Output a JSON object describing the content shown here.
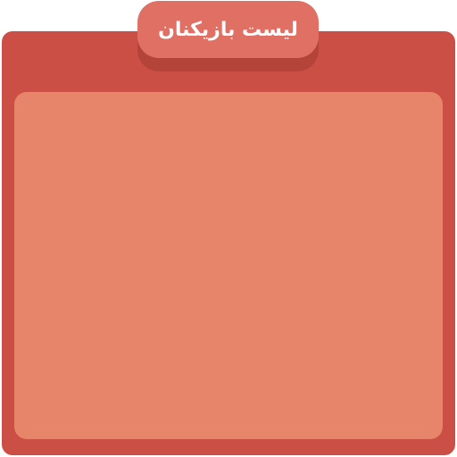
{
  "header": {
    "title": "لیست بازیکنان"
  },
  "colors": {
    "panel": "#cb4f45",
    "panel_inner": "#e68569",
    "tab": "#e06f64",
    "tab_shadow": "#b4433a",
    "title_text": "#ffffff"
  },
  "players": []
}
